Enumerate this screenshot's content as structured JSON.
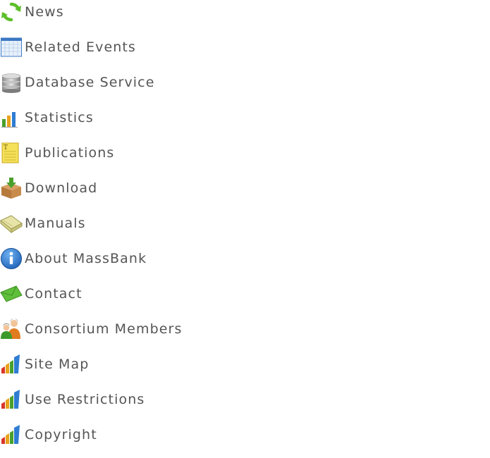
{
  "menu": {
    "items": [
      {
        "label": "News",
        "icon": "refresh-icon"
      },
      {
        "label": "Related Events",
        "icon": "calendar-icon"
      },
      {
        "label": "Database Service",
        "icon": "database-icon"
      },
      {
        "label": "Statistics",
        "icon": "bar-chart-icon"
      },
      {
        "label": "Publications",
        "icon": "notepad-icon"
      },
      {
        "label": "Download",
        "icon": "download-box-icon"
      },
      {
        "label": "Manuals",
        "icon": "book-icon"
      },
      {
        "label": "About MassBank",
        "icon": "info-icon"
      },
      {
        "label": "Contact",
        "icon": "envelope-icon"
      },
      {
        "label": "Consortium Members",
        "icon": "people-icon"
      },
      {
        "label": "Site Map",
        "icon": "chart-bars-icon"
      },
      {
        "label": "Use Restrictions",
        "icon": "chart-bars-icon"
      },
      {
        "label": "Copyright",
        "icon": "chart-bars-icon"
      }
    ]
  },
  "colors": {
    "text": "#555555",
    "background": "#ffffff"
  }
}
